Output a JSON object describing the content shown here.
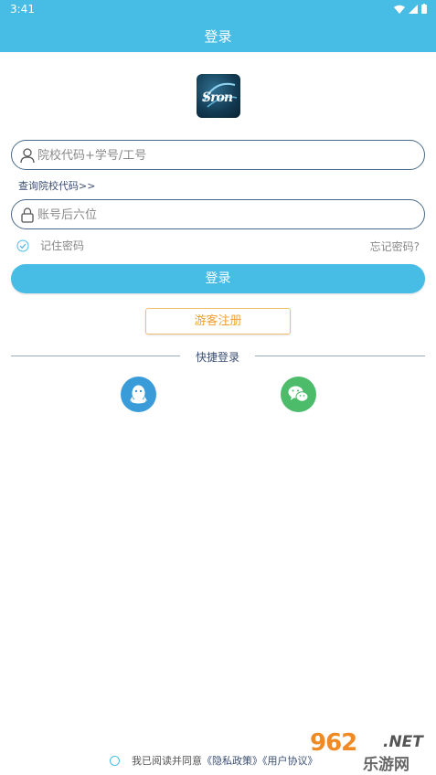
{
  "status": {
    "time": "3:41"
  },
  "header": {
    "title": "登录"
  },
  "logo": {
    "text": "Sron"
  },
  "form": {
    "account_placeholder": "院校代码+学号/工号",
    "query_link": "查询院校代码>>",
    "password_placeholder": "账号后六位",
    "remember_label": "记住密码",
    "forgot_label": "忘记密码?",
    "login_label": "登录",
    "guest_label": "游客注册"
  },
  "quick_login": {
    "label": "快捷登录",
    "options": [
      "qq-icon",
      "wechat-icon"
    ]
  },
  "agreement": {
    "prefix": "我已阅读并同意",
    "privacy": "《隐私政策》",
    "terms": "《用户协议》"
  },
  "watermark": {
    "number": "962",
    "suffix": ".NET",
    "site": "乐游网"
  },
  "colors": {
    "primary": "#47bde6",
    "guest": "#f0a030",
    "qq": "#3a9bd9",
    "wechat": "#4cbb6a"
  }
}
